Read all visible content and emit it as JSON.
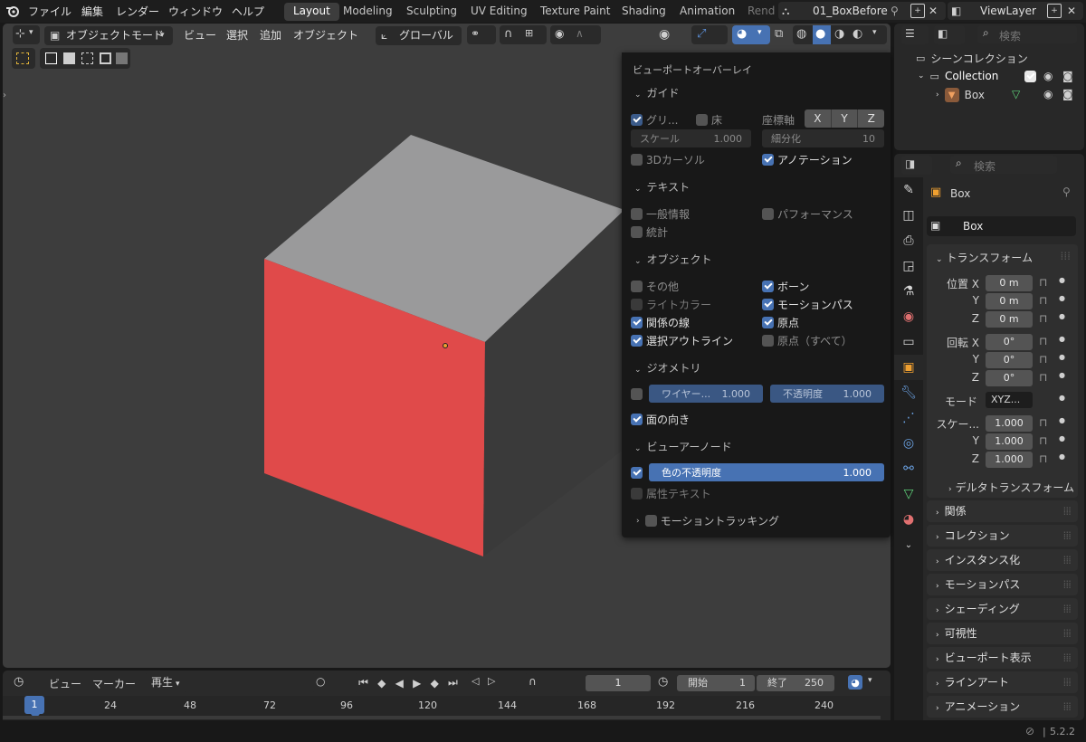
{
  "topbar": {
    "menus": [
      "ファイル",
      "編集",
      "レンダー",
      "ウィンドウ",
      "ヘルプ"
    ],
    "workspaces": [
      "Layout",
      "Modeling",
      "Sculpting",
      "UV Editing",
      "Texture Paint",
      "Shading",
      "Animation",
      "Rend"
    ],
    "scene_name": "01_BoxBefore",
    "view_layer": "ViewLayer"
  },
  "viewport_header": {
    "mode": "オブジェクトモード",
    "menus": [
      "ビュー",
      "選択",
      "追加",
      "オブジェクト"
    ],
    "transform_orientation": "グローバル"
  },
  "overlay": {
    "title": "ビューポートオーバーレイ",
    "guides": {
      "header": "ガイド",
      "grid": "グリ...",
      "floor": "床",
      "axes_label": "座標軸",
      "x": "X",
      "y": "Y",
      "z": "Z",
      "scale_label": "スケール",
      "scale_value": "1.000",
      "subdiv_label": "細分化",
      "subdiv_value": "10",
      "cursor": "3Dカーソル",
      "annotation": "アノテーション"
    },
    "text": {
      "header": "テキスト",
      "stats_info": "一般情報",
      "performance": "パフォーマンス",
      "statistics": "統計"
    },
    "objects": {
      "header": "オブジェクト",
      "extras": "その他",
      "bones": "ボーン",
      "light_colors": "ライトカラー",
      "motion_paths": "モーションパス",
      "relations": "関係の線",
      "origins": "原点",
      "outline": "選択アウトライン",
      "origins_all": "原点（すべて）"
    },
    "geometry": {
      "header": "ジオメトリ",
      "wireframe_label": "ワイヤー...",
      "wireframe_value": "1.000",
      "opacity_label": "不透明度",
      "opacity_value": "1.000",
      "face_orientation": "面の向き"
    },
    "viewer_node": {
      "header": "ビューアーノード",
      "color_opacity_label": "色の不透明度",
      "color_opacity_value": "1.000",
      "attribute_text": "属性テキスト"
    },
    "motion_tracking": "モーショントラッキング"
  },
  "outliner": {
    "scene_collection": "シーンコレクション",
    "collection": "Collection",
    "object": "Box",
    "search_placeholder": "検索"
  },
  "properties": {
    "search_placeholder": "検索",
    "object_name": "Box",
    "datablock_name": "Box",
    "transform": {
      "header": "トランスフォーム",
      "location_label": "位置 X",
      "loc": [
        "0 m",
        "0 m",
        "0 m"
      ],
      "rotation_label": "回転 X",
      "rot": [
        "0°",
        "0°",
        "0°"
      ],
      "mode_label": "モード",
      "mode_value": "XYZ...",
      "scale_label": "スケー...",
      "scale": [
        "1.000",
        "1.000",
        "1.000"
      ],
      "y": "Y",
      "z": "Z",
      "delta": "デルタトランスフォーム"
    },
    "panels": [
      "関係",
      "コレクション",
      "インスタンス化",
      "モーションパス",
      "シェーディング",
      "可視性",
      "ビューポート表示",
      "ラインアート",
      "アニメーション"
    ]
  },
  "timeline": {
    "menus": [
      "ビュー",
      "マーカー"
    ],
    "playback": "再生",
    "current_frame": "1",
    "start_label": "開始",
    "start": "1",
    "end_label": "終了",
    "end": "250",
    "ruler": [
      "1",
      "24",
      "48",
      "72",
      "96",
      "120",
      "144",
      "168",
      "192",
      "216",
      "240"
    ]
  },
  "status": {
    "version": "5.2.2"
  },
  "colors": {
    "accent": "#4772b3",
    "cube_top": "#9a9a9b",
    "cube_front": "#e04a4a",
    "cube_side": "#3a3a3a",
    "viewport_bg": "#3d3d3d"
  }
}
